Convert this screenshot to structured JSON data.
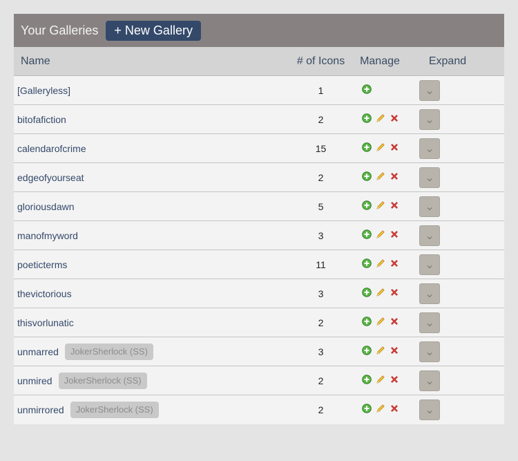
{
  "header": {
    "title": "Your Galleries",
    "new_gallery_label": "+ New Gallery"
  },
  "columns": {
    "name": "Name",
    "count": "# of Icons",
    "manage": "Manage",
    "expand": "Expand"
  },
  "icons": {
    "add": "add-icon",
    "edit": "pencil-icon",
    "delete": "delete-x-icon",
    "expand": "chevron-down-icon"
  },
  "galleries": [
    {
      "name": "[Galleryless]",
      "count": "1",
      "tag": "",
      "editable": false
    },
    {
      "name": "bitofafiction",
      "count": "2",
      "tag": "",
      "editable": true
    },
    {
      "name": "calendarofcrime",
      "count": "15",
      "tag": "",
      "editable": true
    },
    {
      "name": "edgeofyourseat",
      "count": "2",
      "tag": "",
      "editable": true
    },
    {
      "name": "gloriousdawn",
      "count": "5",
      "tag": "",
      "editable": true
    },
    {
      "name": "manofmyword",
      "count": "3",
      "tag": "",
      "editable": true
    },
    {
      "name": "poeticterms",
      "count": "11",
      "tag": "",
      "editable": true
    },
    {
      "name": "thevictorious",
      "count": "3",
      "tag": "",
      "editable": true
    },
    {
      "name": "thisvorlunatic",
      "count": "2",
      "tag": "",
      "editable": true
    },
    {
      "name": "unmarred",
      "count": "3",
      "tag": "JokerSherlock (SS)",
      "editable": true
    },
    {
      "name": "unmired",
      "count": "2",
      "tag": "JokerSherlock (SS)",
      "editable": true
    },
    {
      "name": "unmirrored",
      "count": "2",
      "tag": "JokerSherlock (SS)",
      "editable": true
    }
  ]
}
